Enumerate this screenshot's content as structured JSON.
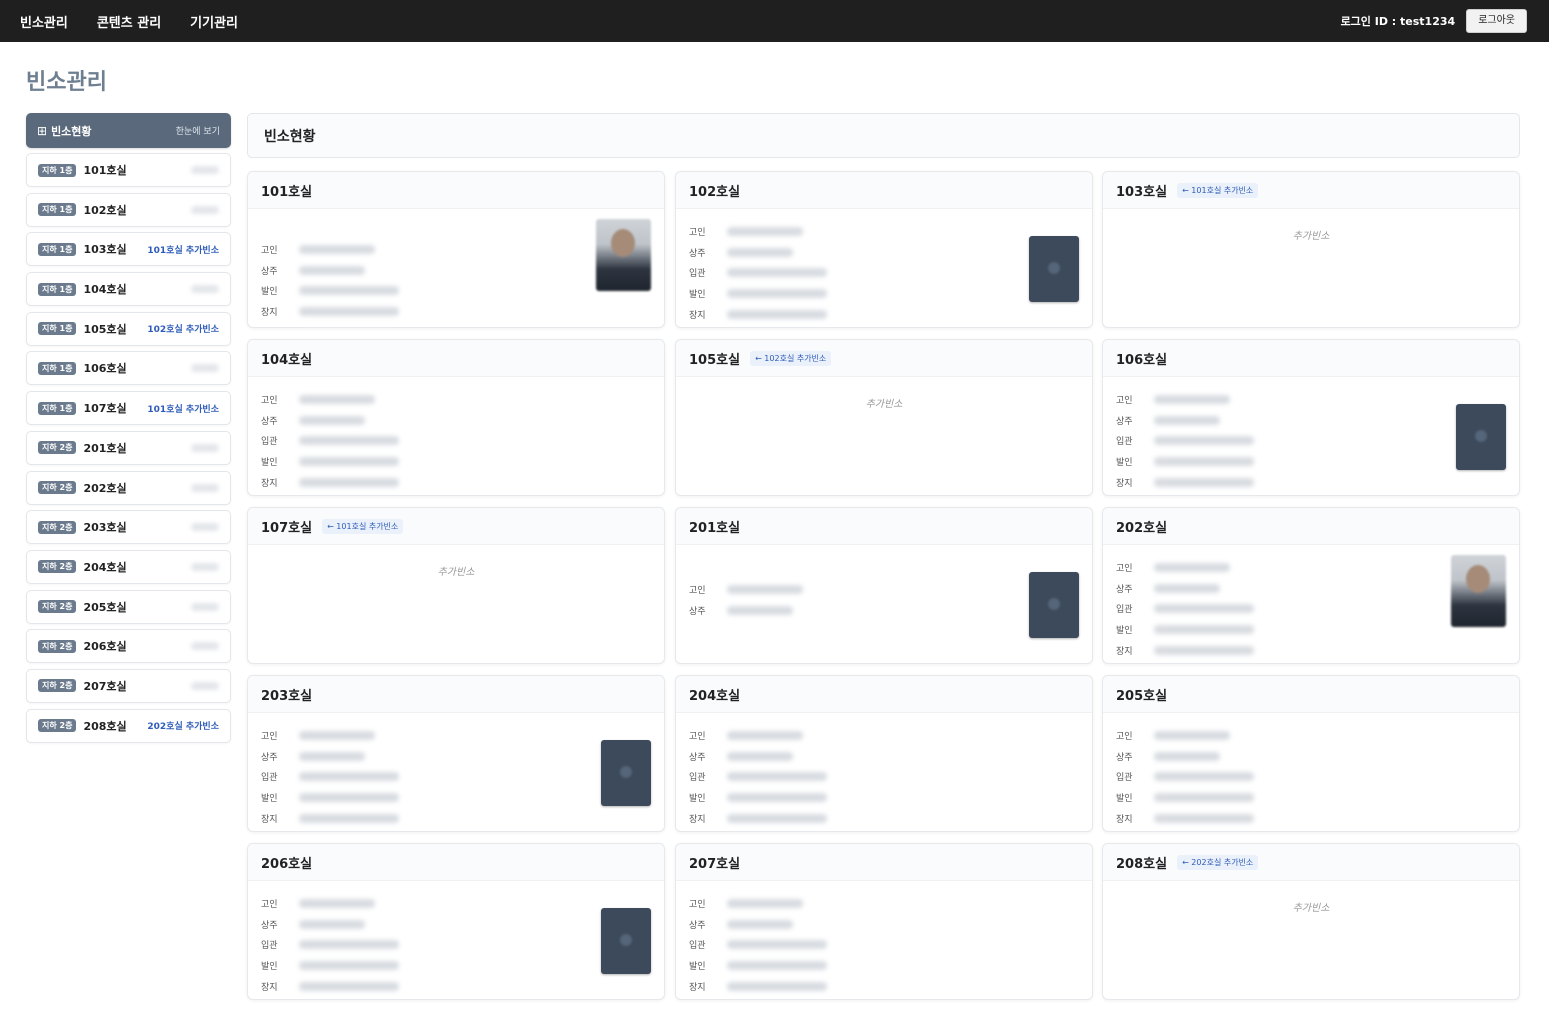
{
  "nav": {
    "items": [
      "빈소관리",
      "콘텐츠 관리",
      "기기관리"
    ],
    "login_label": "로그인 ID : test1234",
    "logout_label": "로그아웃"
  },
  "page_title": "빈소관리",
  "sidebar": {
    "header": {
      "label": "빈소현황",
      "right": "한눈에 보기"
    },
    "items": [
      {
        "floor": "지하 1층",
        "room": "101호실",
        "extra": ""
      },
      {
        "floor": "지하 1층",
        "room": "102호실",
        "extra": ""
      },
      {
        "floor": "지하 1층",
        "room": "103호실",
        "extra": "101호실 추가빈소"
      },
      {
        "floor": "지하 1층",
        "room": "104호실",
        "extra": ""
      },
      {
        "floor": "지하 1층",
        "room": "105호실",
        "extra": "102호실 추가빈소"
      },
      {
        "floor": "지하 1층",
        "room": "106호실",
        "extra": ""
      },
      {
        "floor": "지하 1층",
        "room": "107호실",
        "extra": "101호실 추가빈소"
      },
      {
        "floor": "지하 2층",
        "room": "201호실",
        "extra": ""
      },
      {
        "floor": "지하 2층",
        "room": "202호실",
        "extra": ""
      },
      {
        "floor": "지하 2층",
        "room": "203호실",
        "extra": ""
      },
      {
        "floor": "지하 2층",
        "room": "204호실",
        "extra": ""
      },
      {
        "floor": "지하 2층",
        "room": "205호실",
        "extra": ""
      },
      {
        "floor": "지하 2층",
        "room": "206호실",
        "extra": ""
      },
      {
        "floor": "지하 2층",
        "room": "207호실",
        "extra": ""
      },
      {
        "floor": "지하 2층",
        "room": "208호실",
        "extra": "202호실 추가빈소"
      }
    ]
  },
  "main": {
    "header": "빈소현황",
    "empty_text": "추가빈소",
    "cards": [
      {
        "title": "101호실",
        "tag": "",
        "fields": [
          "고인",
          "상주",
          "발인",
          "장지"
        ],
        "photo": "person",
        "photo-icon": "person-photo-icon"
      },
      {
        "title": "102호실",
        "tag": "",
        "fields": [
          "고인",
          "상주",
          "입관",
          "발인",
          "장지"
        ],
        "photo": "frame"
      },
      {
        "title": "103호실",
        "tag": "← 101호실 추가빈소",
        "fields": [],
        "photo": ""
      },
      {
        "title": "104호실",
        "tag": "",
        "fields": [
          "고인",
          "상주",
          "입관",
          "발인",
          "장지"
        ],
        "photo": ""
      },
      {
        "title": "105호실",
        "tag": "← 102호실 추가빈소",
        "fields": [],
        "photo": ""
      },
      {
        "title": "106호실",
        "tag": "",
        "fields": [
          "고인",
          "상주",
          "입관",
          "발인",
          "장지"
        ],
        "photo": "frame"
      },
      {
        "title": "107호실",
        "tag": "← 101호실 추가빈소",
        "fields": [],
        "photo": ""
      },
      {
        "title": "201호실",
        "tag": "",
        "fields": [
          "고인",
          "상주"
        ],
        "photo": "frame"
      },
      {
        "title": "202호실",
        "tag": "",
        "fields": [
          "고인",
          "상주",
          "입관",
          "발인",
          "장지"
        ],
        "photo": "person"
      },
      {
        "title": "203호실",
        "tag": "",
        "fields": [
          "고인",
          "상주",
          "입관",
          "발인",
          "장지"
        ],
        "photo": "frame"
      },
      {
        "title": "204호실",
        "tag": "",
        "fields": [
          "고인",
          "상주",
          "입관",
          "발인",
          "장지"
        ],
        "photo": ""
      },
      {
        "title": "205호실",
        "tag": "",
        "fields": [
          "고인",
          "상주",
          "입관",
          "발인",
          "장지"
        ],
        "photo": ""
      },
      {
        "title": "206호실",
        "tag": "",
        "fields": [
          "고인",
          "상주",
          "입관",
          "발인",
          "장지"
        ],
        "photo": "frame"
      },
      {
        "title": "207호실",
        "tag": "",
        "fields": [
          "고인",
          "상주",
          "입관",
          "발인",
          "장지"
        ],
        "photo": ""
      },
      {
        "title": "208호실",
        "tag": "← 202호실 추가빈소",
        "fields": [],
        "photo": ""
      }
    ]
  }
}
